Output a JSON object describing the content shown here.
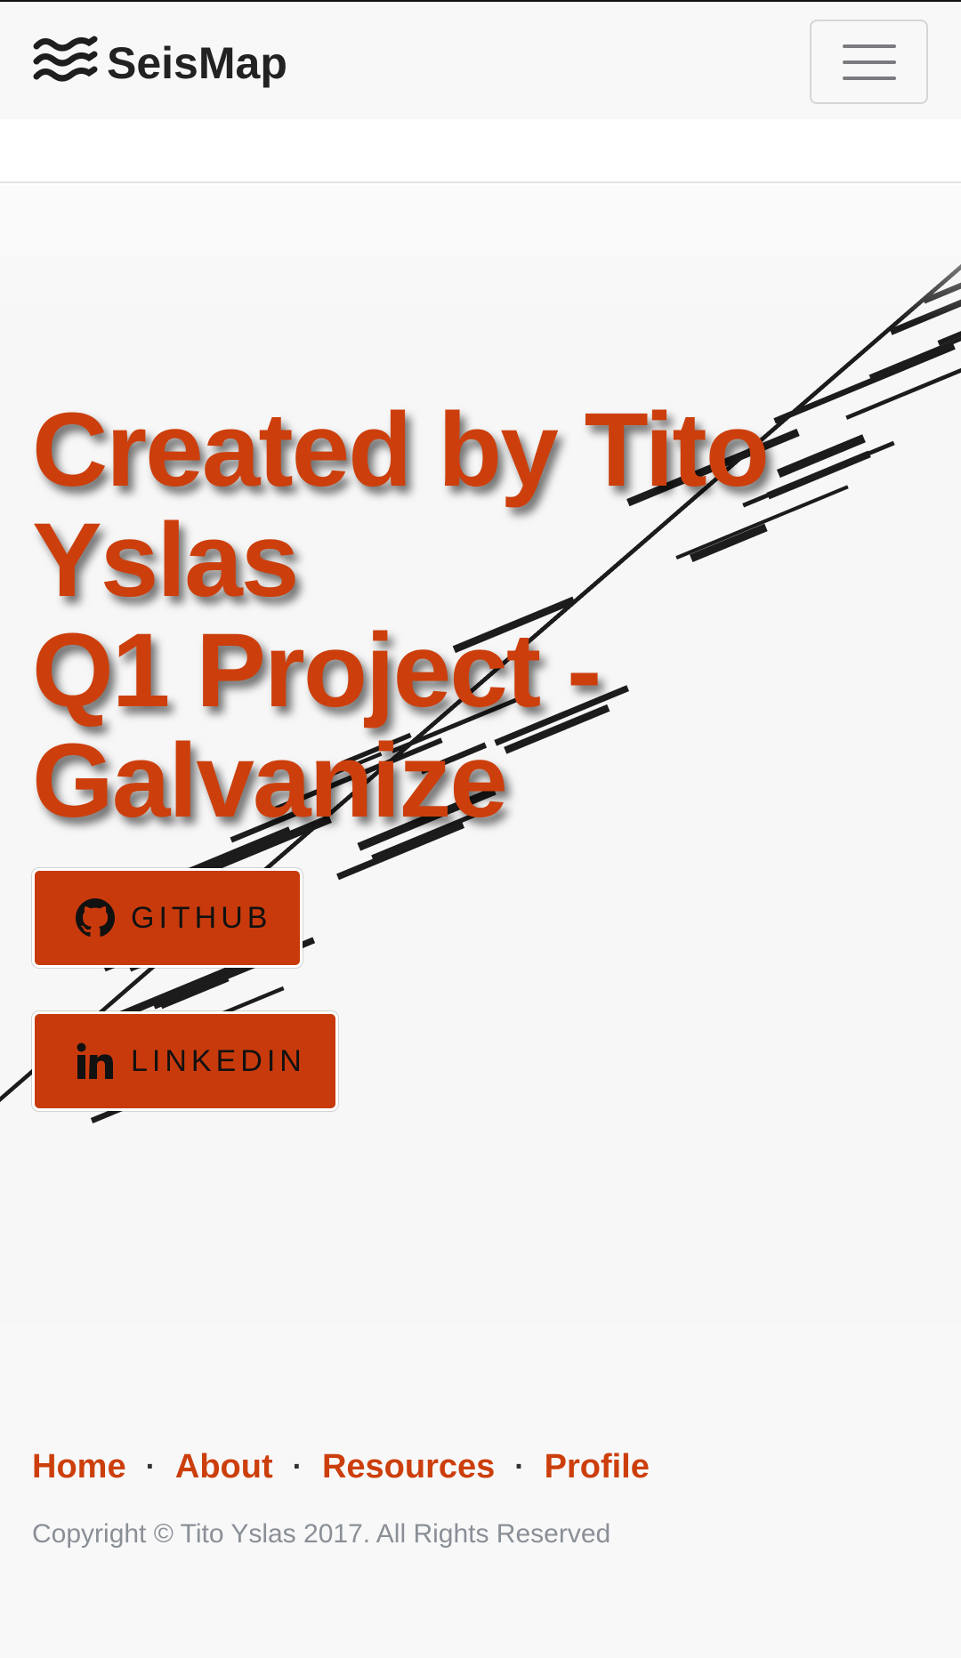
{
  "navbar": {
    "brand_text": "SeisMap",
    "brand_logo_icon": "waves-icon",
    "toggle_icon": "hamburger-menu-icon"
  },
  "hero": {
    "title_lines": [
      "Created by Tito",
      "Yslas",
      "Q1 Project -",
      "Galvanize"
    ],
    "background_icon": "seismogram-waveform",
    "buttons": [
      {
        "label": "GITHUB",
        "icon": "github-icon"
      },
      {
        "label": "LINKEDIN",
        "icon": "linkedin-icon"
      }
    ]
  },
  "footer": {
    "links": [
      {
        "label": "Home"
      },
      {
        "label": "About"
      },
      {
        "label": "Resources"
      },
      {
        "label": "Profile"
      }
    ],
    "separator": "·",
    "copyright": "Copyright © Tito Yslas 2017. All Rights Reserved"
  },
  "colors": {
    "accent": "#cc3f0c",
    "button_bg": "#c83a0c",
    "navbar_bg": "#f8f8f9",
    "footer_bg": "#f8f8f9",
    "copyright_text": "#8a8f96"
  }
}
